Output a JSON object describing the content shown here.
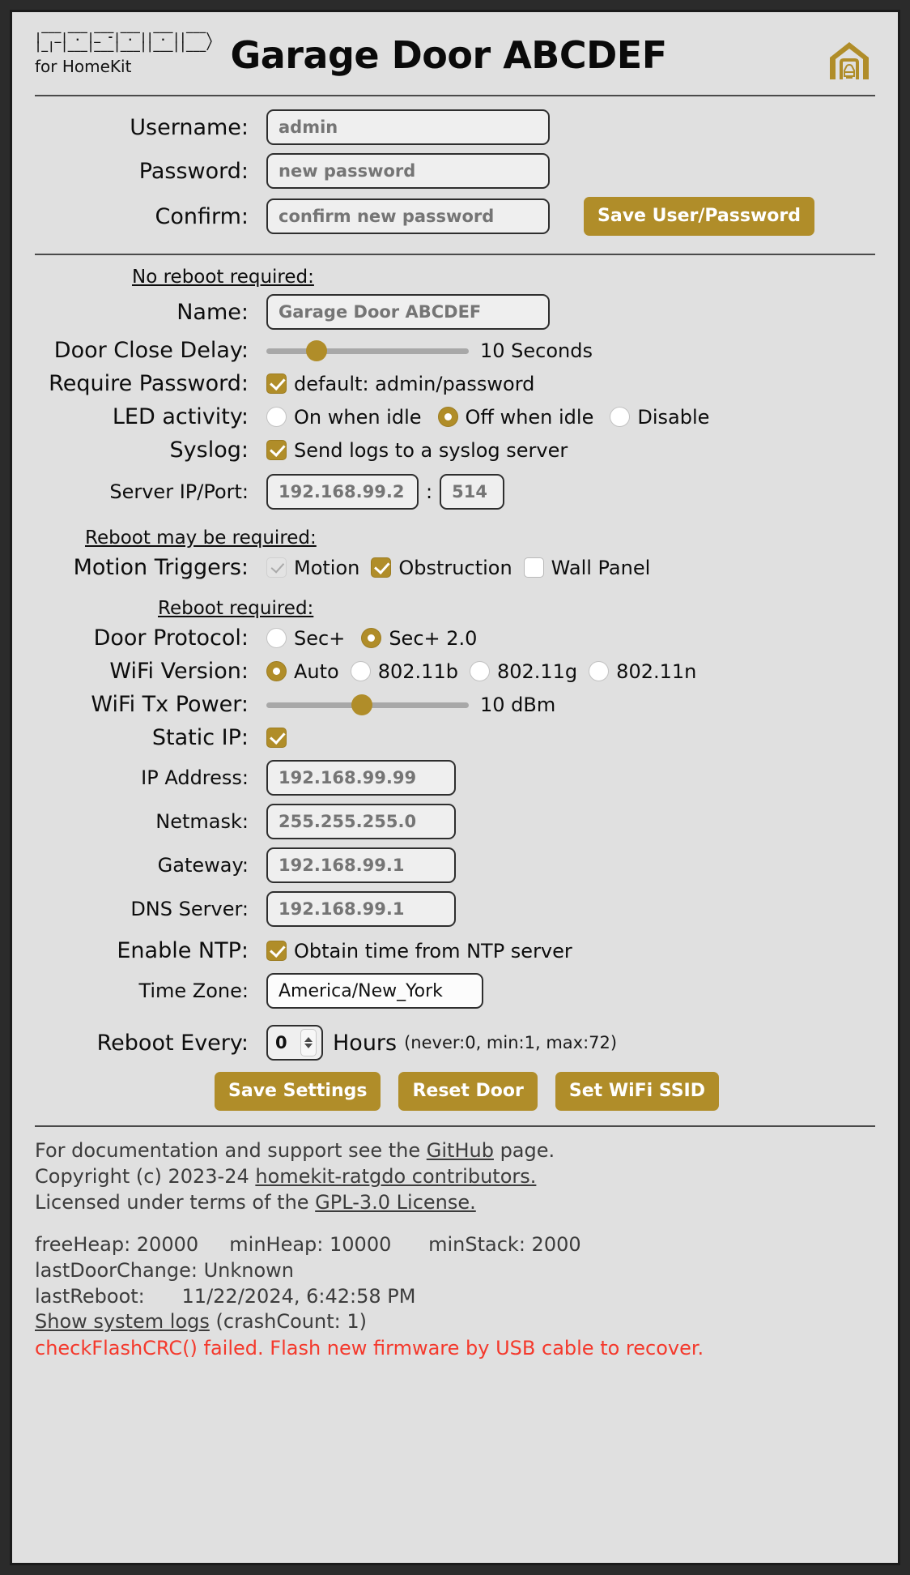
{
  "theme": {
    "accent": "#b08d29",
    "page_bg": "#e0e0e0",
    "error": "#f4392c",
    "text": "#0d0d0d"
  },
  "header": {
    "ascii_logo": " ___ ___ ___ ___  ___  ___\n|  _| . |_ -| . || . ||   \\\n|_| |___|___|___||___||___/",
    "subtitle": "for HomeKit",
    "title": "Garage Door ABCDEF",
    "icon": "garage-house-icon"
  },
  "auth": {
    "username_label": "Username:",
    "username_placeholder": "admin",
    "password_label": "Password:",
    "password_placeholder": "new password",
    "confirm_label": "Confirm:",
    "confirm_placeholder": "confirm new password",
    "save_button": "Save User/Password"
  },
  "sections": {
    "no_reboot": "No reboot required:",
    "may_reboot": "Reboot may be required:",
    "reboot_required": "Reboot required:"
  },
  "settings": {
    "name_label": "Name:",
    "name_placeholder": "Garage Door ABCDEF",
    "door_close_delay_label": "Door Close Delay:",
    "door_close_delay_value": "10 Seconds",
    "door_close_delay_pct": 22,
    "require_password_label": "Require Password:",
    "require_password_text": "default: admin/password",
    "require_password_checked": true,
    "led_label": "LED activity:",
    "led_options": [
      {
        "label": "On when idle",
        "selected": false
      },
      {
        "label": "Off when idle",
        "selected": true
      },
      {
        "label": "Disable",
        "selected": false
      }
    ],
    "syslog_label": "Syslog:",
    "syslog_text": "Send logs to a syslog server",
    "syslog_checked": true,
    "server_label": "Server IP/Port:",
    "server_ip_placeholder": "192.168.99.2",
    "server_port_placeholder": "514",
    "server_separator": ":",
    "motion_triggers_label": "Motion Triggers:",
    "motion_triggers": [
      {
        "label": "Motion",
        "checked": true,
        "disabled": true
      },
      {
        "label": "Obstruction",
        "checked": true,
        "disabled": false
      },
      {
        "label": "Wall Panel",
        "checked": false,
        "disabled": false
      }
    ],
    "door_protocol_label": "Door Protocol:",
    "door_protocol_options": [
      {
        "label": "Sec+",
        "selected": false
      },
      {
        "label": "Sec+ 2.0",
        "selected": true
      }
    ],
    "wifi_version_label": "WiFi Version:",
    "wifi_version_options": [
      {
        "label": "Auto",
        "selected": true
      },
      {
        "label": "802.11b",
        "selected": false
      },
      {
        "label": "802.11g",
        "selected": false
      },
      {
        "label": "802.11n",
        "selected": false
      }
    ],
    "wifi_tx_label": "WiFi Tx Power:",
    "wifi_tx_value": "10 dBm",
    "wifi_tx_pct": 47,
    "static_ip_label": "Static IP:",
    "static_ip_checked": true,
    "ip_address_label": "IP Address:",
    "ip_address_placeholder": "192.168.99.99",
    "netmask_label": "Netmask:",
    "netmask_placeholder": "255.255.255.0",
    "gateway_label": "Gateway:",
    "gateway_placeholder": "192.168.99.1",
    "dns_label": "DNS Server:",
    "dns_placeholder": "192.168.99.1",
    "ntp_label": "Enable NTP:",
    "ntp_text": "Obtain time from NTP server",
    "ntp_checked": true,
    "timezone_label": "Time Zone:",
    "timezone_value": "America/New_York",
    "reboot_every_label": "Reboot Every:",
    "reboot_every_value": "0",
    "hours_word": "Hours",
    "hours_note": "(never:0, min:1, max:72)"
  },
  "actions": {
    "save_settings": "Save Settings",
    "reset_door": "Reset Door",
    "set_wifi_ssid": "Set WiFi SSID"
  },
  "footer": {
    "line1_pre": "For documentation and support see the ",
    "line1_link": "GitHub",
    "line1_post": " page.",
    "line2_pre": "Copyright (c) 2023-24 ",
    "line2_link": "homekit-ratgdo contributors.",
    "line3_pre": "Licensed under terms of the ",
    "line3_link": "GPL-3.0 License.",
    "stat_heap": "freeHeap: 20000     minHeap: 10000      minStack: 2000",
    "stat_last_door": "lastDoorChange: Unknown",
    "stat_last_reboot": "lastReboot:      11/22/2024, 6:42:58 PM",
    "logs_link": "Show system logs",
    "crash_count": " (crashCount: 1)",
    "error": "checkFlashCRC() failed. Flash new firmware by USB cable to recover."
  }
}
